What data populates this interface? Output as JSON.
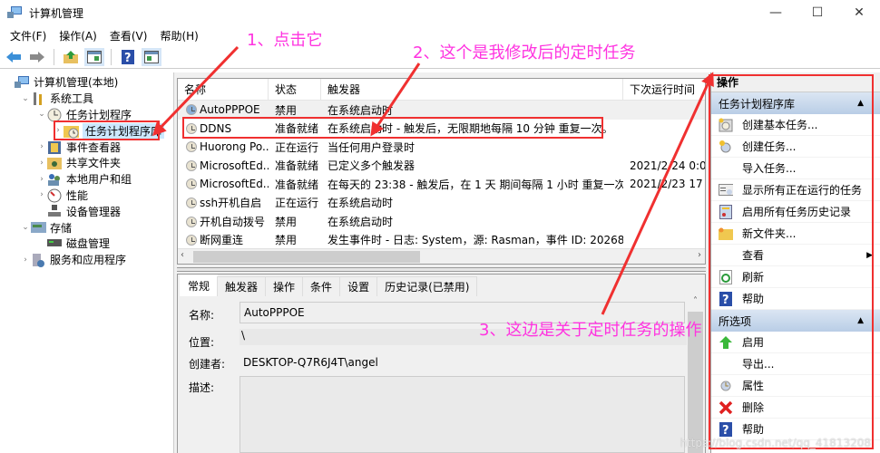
{
  "window": {
    "title": "计算机管理",
    "minimize": "—",
    "maximize": "☐",
    "close": "✕"
  },
  "menu": [
    "文件(F)",
    "操作(A)",
    "查看(V)",
    "帮助(H)"
  ],
  "toolbar": {
    "back_icon": "back-arrow-icon",
    "forward_icon": "forward-arrow-icon",
    "up_icon": "up-folder-icon",
    "console_icon": "show-hide-console-tree-icon",
    "help_icon": "help-icon",
    "action_pane_icon": "show-hide-action-pane-icon"
  },
  "tree": [
    {
      "label": "计算机管理(本地)",
      "level": 0,
      "expander": "",
      "icon": "computer-management-icon"
    },
    {
      "label": "系统工具",
      "level": 1,
      "expander": "⌄",
      "icon": "tools-icon"
    },
    {
      "label": "任务计划程序",
      "level": 2,
      "expander": "⌄",
      "icon": "clock-icon"
    },
    {
      "label": "任务计划程序库",
      "level": 3,
      "expander": "›",
      "icon": "folder-clock-icon",
      "selected": true
    },
    {
      "label": "事件查看器",
      "level": 2,
      "expander": "›",
      "icon": "event-viewer-icon"
    },
    {
      "label": "共享文件夹",
      "level": 2,
      "expander": "›",
      "icon": "shared-folder-icon"
    },
    {
      "label": "本地用户和组",
      "level": 2,
      "expander": "›",
      "icon": "users-icon"
    },
    {
      "label": "性能",
      "level": 2,
      "expander": "›",
      "icon": "performance-icon"
    },
    {
      "label": "设备管理器",
      "level": 2,
      "expander": "",
      "icon": "device-manager-icon"
    },
    {
      "label": "存储",
      "level": 1,
      "expander": "⌄",
      "icon": "storage-icon"
    },
    {
      "label": "磁盘管理",
      "level": 2,
      "expander": "",
      "icon": "disk-icon"
    },
    {
      "label": "服务和应用程序",
      "level": 1,
      "expander": "›",
      "icon": "services-icon"
    }
  ],
  "task_list": {
    "columns": [
      "名称",
      "状态",
      "触发器",
      "下次运行时间"
    ],
    "rows": [
      {
        "name": "AutoPPPOE",
        "status": "禁用",
        "trigger": "在系统启动时",
        "next": ""
      },
      {
        "name": "DDNS",
        "status": "准备就绪",
        "trigger": "在系统启动时 - 触发后，无限期地每隔 10 分钟 重复一次。",
        "next": ""
      },
      {
        "name": "Huorong Po...",
        "status": "正在运行",
        "trigger": "当任何用户登录时",
        "next": ""
      },
      {
        "name": "MicrosoftEd...",
        "status": "准备就绪",
        "trigger": "已定义多个触发器",
        "next": "2021/2/24 0:0"
      },
      {
        "name": "MicrosoftEd...",
        "status": "准备就绪",
        "trigger": "在每天的 23:38 - 触发后，在 1 天 期间每隔 1 小时 重复一次。",
        "next": "2021/2/23 17"
      },
      {
        "name": "ssh开机自启",
        "status": "正在运行",
        "trigger": "在系统启动时",
        "next": ""
      },
      {
        "name": "开机自动拨号",
        "status": "禁用",
        "trigger": "在系统启动时",
        "next": ""
      },
      {
        "name": "断网重连",
        "status": "禁用",
        "trigger": "发生事件时 - 日志: System，源: Rasman，事件 ID: 20268",
        "next": ""
      }
    ]
  },
  "detail": {
    "tabs": [
      "常规",
      "触发器",
      "操作",
      "条件",
      "设置",
      "历史记录(已禁用)"
    ],
    "active_tab": "常规",
    "fields": {
      "name_label": "名称:",
      "name_value": "AutoPPPOE",
      "location_label": "位置:",
      "location_value": "\\",
      "author_label": "创建者:",
      "author_value": "DESKTOP-Q7R6J4T\\angel",
      "description_label": "描述:",
      "description_value": ""
    }
  },
  "actions": {
    "header": "操作",
    "sections": [
      {
        "title": "任务计划程序库",
        "items": [
          {
            "label": "创建基本任务...",
            "icon": "create-basic-task-icon"
          },
          {
            "label": "创建任务...",
            "icon": "create-task-icon"
          },
          {
            "label": "导入任务...",
            "icon": ""
          },
          {
            "label": "显示所有正在运行的任务",
            "icon": "running-tasks-icon"
          },
          {
            "label": "启用所有任务历史记录",
            "icon": "history-icon"
          },
          {
            "label": "新文件夹...",
            "icon": "new-folder-icon"
          },
          {
            "label": "查看",
            "icon": "",
            "submenu": true
          },
          {
            "label": "刷新",
            "icon": "refresh-icon"
          },
          {
            "label": "帮助",
            "icon": "help-icon"
          }
        ]
      },
      {
        "title": "所选项",
        "items": [
          {
            "label": "启用",
            "icon": "enable-icon"
          },
          {
            "label": "导出...",
            "icon": ""
          },
          {
            "label": "属性",
            "icon": "properties-icon"
          },
          {
            "label": "删除",
            "icon": "delete-icon"
          },
          {
            "label": "帮助",
            "icon": "help-icon"
          }
        ]
      }
    ]
  },
  "annotations": {
    "a1": "1、点击它",
    "a2": "2、这个是我修改后的定时任务",
    "a3": "3、这边是关于定时任务的操作"
  },
  "colors": {
    "annotation": "#ff33e0",
    "highlight_box": "#f03030",
    "section_header": "#c8d8ec"
  },
  "watermark": "https://blog.csdn.net/qq_41813208"
}
